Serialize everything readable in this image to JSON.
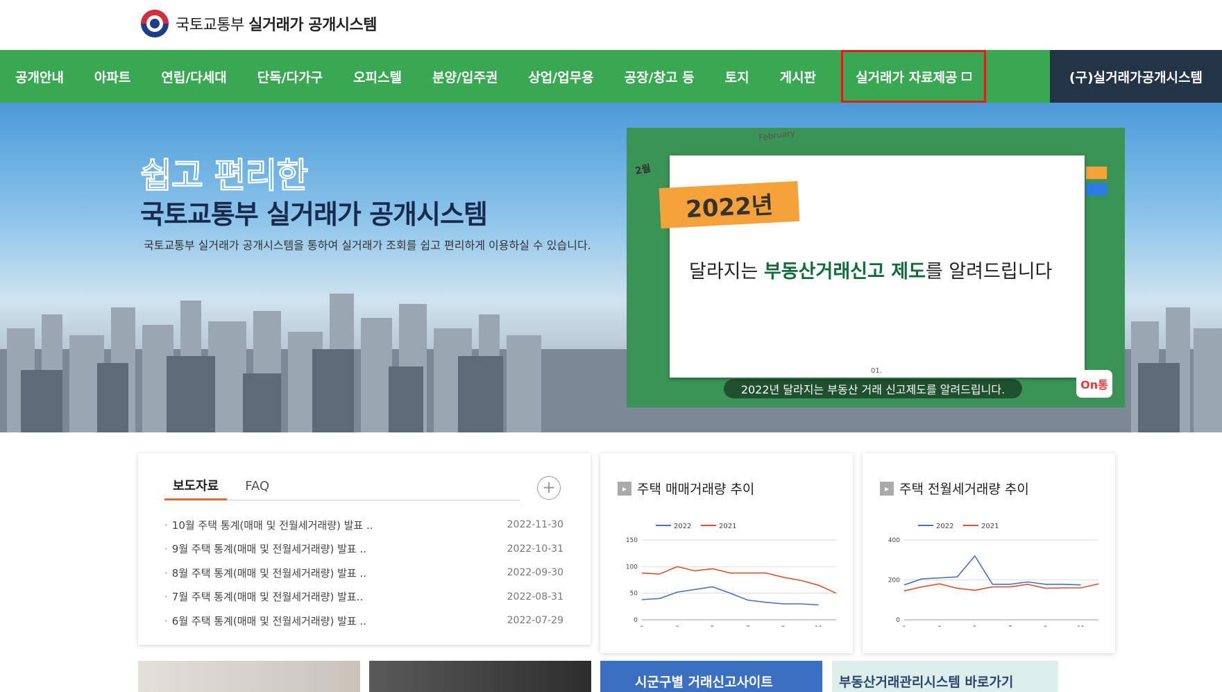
{
  "header": {
    "ministry": "국토교통부",
    "system": "실거래가 공개시스템"
  },
  "nav": {
    "items": [
      "공개안내",
      "아파트",
      "연립/다세대",
      "단독/다가구",
      "오피스텔",
      "분양/입주권",
      "상업/업무용",
      "공장/창고 등",
      "토지",
      "게시판"
    ],
    "data_provision": "실거래가 자료제공",
    "old_system": "(구)실거래가공개시스템"
  },
  "hero": {
    "title1": "쉽고 편리한",
    "title2": "국토교통부 실거래가 공개시스템",
    "desc": "국토교통부 실거래가 공개시스템을 통하여 실거래가 조회를 쉽고 편리하게 이용하실 수 있습니다.",
    "video": {
      "month": "2월",
      "feb": "February",
      "year": "2022년",
      "msg_pre": "달라지는 ",
      "msg_bold": "부동산거래신고 제도",
      "msg_post": "를 알려드립니다",
      "num": "01.",
      "caption": "2022년 달라지는 부동산 거래 신고제도를 알려드립니다.",
      "badge": "On통"
    }
  },
  "news": {
    "tab_press": "보도자료",
    "tab_faq": "FAQ",
    "plus": "+",
    "items": [
      {
        "title": "10월 주택 통계(매매 및 전월세거래량) 발표 ..",
        "date": "2022-11-30"
      },
      {
        "title": "9월 주택 통계(매매 및 전월세거래량) 발표 ..",
        "date": "2022-10-31"
      },
      {
        "title": "8월 주택 통계(매매 및 전월세거래량) 발표 ..",
        "date": "2022-09-30"
      },
      {
        "title": "7월 주택 통계(매매 및 전월세거래량) 발표..",
        "date": "2022-08-31"
      },
      {
        "title": "6월 주택 통계(매매 및 전월세거래량) 발표 ..",
        "date": "2022-07-29"
      }
    ]
  },
  "chart_data": [
    {
      "type": "line",
      "title": "주택 매매거래량 추이",
      "x": [
        1,
        2,
        3,
        4,
        5,
        6,
        7,
        8,
        9,
        10,
        11,
        12
      ],
      "xticks": [
        1,
        3,
        5,
        7,
        9,
        11
      ],
      "yticks": [
        0,
        50,
        100,
        150
      ],
      "ylim": [
        0,
        150
      ],
      "series": [
        {
          "name": "2022",
          "color": "#4472c4",
          "values": [
            38,
            40,
            52,
            57,
            62,
            50,
            37,
            33,
            30,
            30,
            28,
            null
          ]
        },
        {
          "name": "2021",
          "color": "#e0502a",
          "values": [
            88,
            86,
            100,
            92,
            96,
            88,
            88,
            88,
            80,
            74,
            65,
            50
          ]
        }
      ]
    },
    {
      "type": "line",
      "title": "주택 전월세거래량 추이",
      "x": [
        1,
        2,
        3,
        4,
        5,
        6,
        7,
        8,
        9,
        10,
        11,
        12
      ],
      "xticks": [
        1,
        3,
        5,
        7,
        9,
        11
      ],
      "yticks": [
        0,
        200,
        400
      ],
      "ylim": [
        0,
        400
      ],
      "series": [
        {
          "name": "2022",
          "color": "#4472c4",
          "values": [
            175,
            205,
            210,
            215,
            320,
            178,
            178,
            190,
            178,
            178,
            175,
            null
          ]
        },
        {
          "name": "2021",
          "color": "#e0502a",
          "values": [
            145,
            165,
            180,
            158,
            148,
            165,
            165,
            178,
            158,
            160,
            160,
            180
          ]
        }
      ]
    }
  ],
  "bottom": {
    "banner1": "시군구별 거래신고사이트",
    "banner2": "부동산거래관리시스템 바로가기"
  }
}
